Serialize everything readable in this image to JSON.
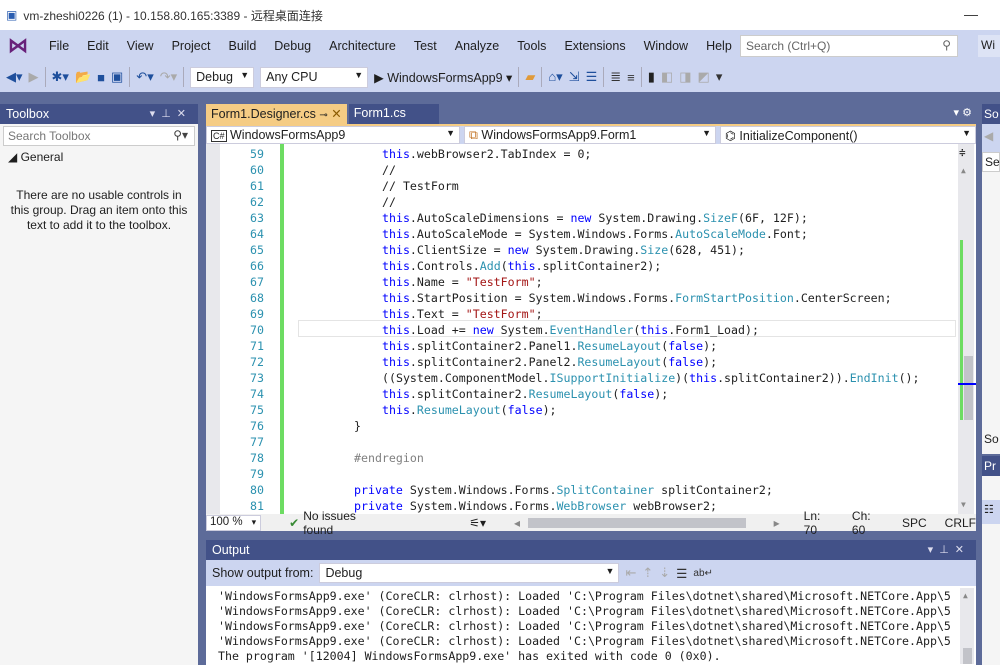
{
  "title": "vm-zheshi0226 (1) - 10.158.80.165:3389 - 远程桌面连接",
  "menu": [
    "File",
    "Edit",
    "View",
    "Project",
    "Build",
    "Debug",
    "Architecture",
    "Test",
    "Analyze",
    "Tools",
    "Extensions",
    "Window",
    "Help"
  ],
  "search_placeholder": "Search (Ctrl+Q)",
  "wi": "Wi",
  "toolbar": {
    "config": "Debug",
    "platform": "Any CPU",
    "start": "WindowsFormsApp9"
  },
  "toolbox": {
    "title": "Toolbox",
    "search_placeholder": "Search Toolbox",
    "group": "General",
    "empty": "There are no usable controls in this group. Drag an item onto this text to add it to the toolbox."
  },
  "tabs": [
    {
      "label": "Form1.Designer.cs",
      "active": true
    },
    {
      "label": "Form1.cs",
      "active": false
    }
  ],
  "nav": {
    "project": "WindowsFormsApp9",
    "class": "WindowsFormsApp9.Form1",
    "member": "InitializeComponent()"
  },
  "code": [
    {
      "n": "59",
      "i": 2,
      "t": [
        [
          "this",
          "k"
        ],
        [
          ".webBrowser2.TabIndex = 0;",
          "c"
        ]
      ]
    },
    {
      "n": "60",
      "i": 2,
      "t": [
        [
          "//",
          "c"
        ]
      ]
    },
    {
      "n": "61",
      "i": 2,
      "t": [
        [
          "// TestForm",
          "c"
        ]
      ]
    },
    {
      "n": "62",
      "i": 2,
      "t": [
        [
          "//",
          "c"
        ]
      ]
    },
    {
      "n": "63",
      "i": 2,
      "t": [
        [
          "this",
          "k"
        ],
        [
          ".AutoScaleDimensions = ",
          "c"
        ],
        [
          "new",
          "k"
        ],
        [
          " System.Drawing.",
          "c"
        ],
        [
          "SizeF",
          "t"
        ],
        [
          "(6F, 12F);",
          "c"
        ]
      ]
    },
    {
      "n": "64",
      "i": 2,
      "t": [
        [
          "this",
          "k"
        ],
        [
          ".AutoScaleMode = System.Windows.Forms.",
          "c"
        ],
        [
          "AutoScaleMode",
          "t"
        ],
        [
          ".Font;",
          "c"
        ]
      ]
    },
    {
      "n": "65",
      "i": 2,
      "t": [
        [
          "this",
          "k"
        ],
        [
          ".ClientSize = ",
          "c"
        ],
        [
          "new",
          "k"
        ],
        [
          " System.Drawing.",
          "c"
        ],
        [
          "Size",
          "t"
        ],
        [
          "(628, 451);",
          "c"
        ]
      ]
    },
    {
      "n": "66",
      "i": 2,
      "t": [
        [
          "this",
          "k"
        ],
        [
          ".Controls.",
          "c"
        ],
        [
          "Add",
          "t"
        ],
        [
          "(",
          "c"
        ],
        [
          "this",
          "k"
        ],
        [
          ".splitContainer2);",
          "c"
        ]
      ]
    },
    {
      "n": "67",
      "i": 2,
      "t": [
        [
          "this",
          "k"
        ],
        [
          ".Name = ",
          "c"
        ],
        [
          "\"TestForm\"",
          "s"
        ],
        [
          ";",
          "c"
        ]
      ]
    },
    {
      "n": "68",
      "i": 2,
      "t": [
        [
          "this",
          "k"
        ],
        [
          ".StartPosition = System.Windows.Forms.",
          "c"
        ],
        [
          "FormStartPosition",
          "t"
        ],
        [
          ".CenterScreen;",
          "c"
        ]
      ]
    },
    {
      "n": "69",
      "i": 2,
      "t": [
        [
          "this",
          "k"
        ],
        [
          ".Text = ",
          "c"
        ],
        [
          "\"TestForm\"",
          "s"
        ],
        [
          ";",
          "c"
        ]
      ]
    },
    {
      "n": "70",
      "i": 2,
      "t": [
        [
          "this",
          "k"
        ],
        [
          ".Load += ",
          "c"
        ],
        [
          "new",
          "k"
        ],
        [
          " System.",
          "c"
        ],
        [
          "EventHandler",
          "t"
        ],
        [
          "(",
          "c"
        ],
        [
          "this",
          "k"
        ],
        [
          ".Form1_Load);",
          "c"
        ]
      ]
    },
    {
      "n": "71",
      "i": 2,
      "t": [
        [
          "this",
          "k"
        ],
        [
          ".splitContainer2.Panel1.",
          "c"
        ],
        [
          "ResumeLayout",
          "t"
        ],
        [
          "(",
          "c"
        ],
        [
          "false",
          "k"
        ],
        [
          ");",
          "c"
        ]
      ]
    },
    {
      "n": "72",
      "i": 2,
      "t": [
        [
          "this",
          "k"
        ],
        [
          ".splitContainer2.Panel2.",
          "c"
        ],
        [
          "ResumeLayout",
          "t"
        ],
        [
          "(",
          "c"
        ],
        [
          "false",
          "k"
        ],
        [
          ");",
          "c"
        ]
      ]
    },
    {
      "n": "73",
      "i": 2,
      "t": [
        [
          "((System.ComponentModel.",
          "c"
        ],
        [
          "ISupportInitialize",
          "t"
        ],
        [
          ")(",
          "c"
        ],
        [
          "this",
          "k"
        ],
        [
          ".splitContainer2)).",
          "c"
        ],
        [
          "EndInit",
          "t"
        ],
        [
          "();",
          "c"
        ]
      ]
    },
    {
      "n": "74",
      "i": 2,
      "t": [
        [
          "this",
          "k"
        ],
        [
          ".splitContainer2.",
          "c"
        ],
        [
          "ResumeLayout",
          "t"
        ],
        [
          "(",
          "c"
        ],
        [
          "false",
          "k"
        ],
        [
          ");",
          "c"
        ]
      ]
    },
    {
      "n": "75",
      "i": 2,
      "t": [
        [
          "this",
          "k"
        ],
        [
          ".",
          "c"
        ],
        [
          "ResumeLayout",
          "t"
        ],
        [
          "(",
          "c"
        ],
        [
          "false",
          "k"
        ],
        [
          ");",
          "c"
        ]
      ]
    },
    {
      "n": "76",
      "i": 1,
      "t": [
        [
          "}",
          "c"
        ]
      ]
    },
    {
      "n": "77",
      "i": 1,
      "t": []
    },
    {
      "n": "78",
      "i": 1,
      "t": [
        [
          "#endregion",
          "g"
        ]
      ]
    },
    {
      "n": "79",
      "i": 1,
      "t": []
    },
    {
      "n": "80",
      "i": 1,
      "t": [
        [
          "private",
          "k"
        ],
        [
          " System.Windows.Forms.",
          "c"
        ],
        [
          "SplitContainer",
          "t"
        ],
        [
          " splitContainer2;",
          "c"
        ]
      ]
    },
    {
      "n": "81",
      "i": 1,
      "t": [
        [
          "private",
          "k"
        ],
        [
          " System.Windows.Forms.",
          "c"
        ],
        [
          "WebBrowser",
          "t"
        ],
        [
          " webBrowser2;",
          "c"
        ]
      ]
    }
  ],
  "status": {
    "zoom": "100 %",
    "issues": "No issues found",
    "ln": "Ln: 70",
    "ch": "Ch: 60",
    "spc": "SPC",
    "crlf": "CRLF"
  },
  "output": {
    "title": "Output",
    "show_from": "Show output from:",
    "source": "Debug",
    "lines": [
      "'WindowsFormsApp9.exe' (CoreCLR: clrhost): Loaded 'C:\\Program Files\\dotnet\\shared\\Microsoft.NETCore.App\\5",
      "'WindowsFormsApp9.exe' (CoreCLR: clrhost): Loaded 'C:\\Program Files\\dotnet\\shared\\Microsoft.NETCore.App\\5",
      "'WindowsFormsApp9.exe' (CoreCLR: clrhost): Loaded 'C:\\Program Files\\dotnet\\shared\\Microsoft.NETCore.App\\5",
      "'WindowsFormsApp9.exe' (CoreCLR: clrhost): Loaded 'C:\\Program Files\\dotnet\\shared\\Microsoft.NETCore.App\\5",
      "The program '[12004] WindowsFormsApp9.exe' has exited with code 0 (0x0)."
    ]
  },
  "right": {
    "so": "So",
    "se": "Se",
    "so2": "So",
    "pr": "Pr"
  }
}
